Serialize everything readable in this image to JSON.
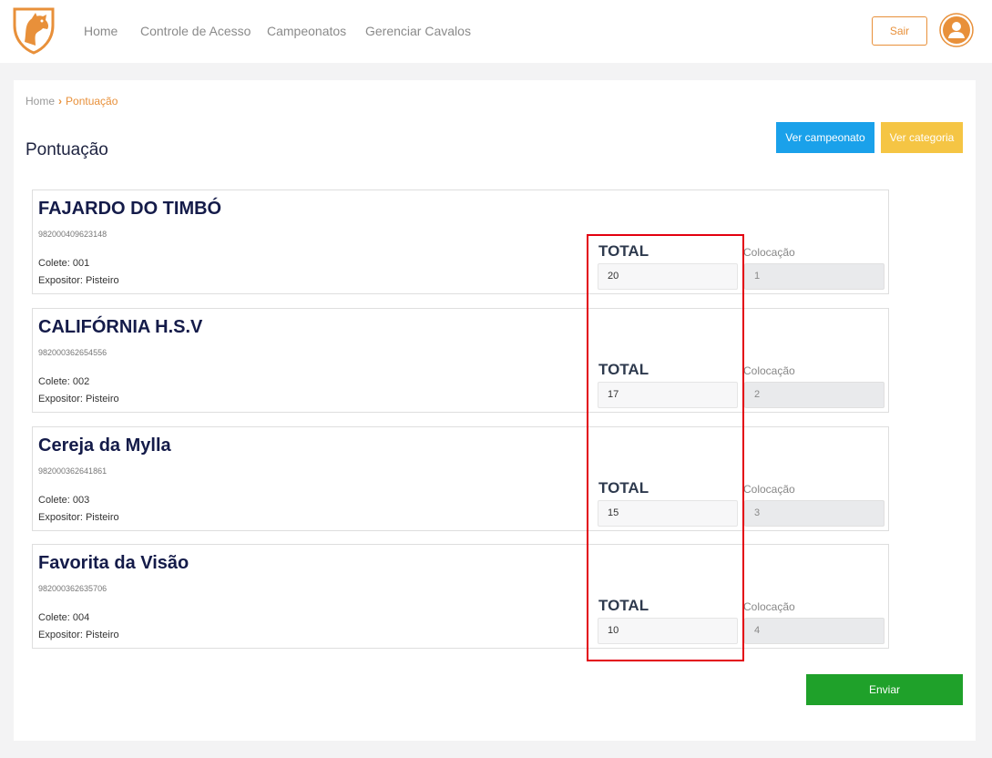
{
  "nav": {
    "items": [
      "Home",
      "Controle de Acesso",
      "Campeonatos",
      "Gerenciar Cavalos"
    ],
    "logout_label": "Sair"
  },
  "breadcrumb": {
    "home": "Home",
    "current": "Pontuação"
  },
  "page": {
    "title": "Pontuação",
    "ver_campeonato": "Ver campeonato",
    "ver_categoria": "Ver categoria",
    "submit_label": "Enviar"
  },
  "horses": [
    {
      "name": "FAJARDO DO TIMBÓ",
      "chip": "982000409623148",
      "colete": "Colete: 001",
      "expositor": "Expositor: Pisteiro",
      "total_label": "TOTAL",
      "total": "20",
      "colocacao_label": "Colocação",
      "colocacao": "1"
    },
    {
      "name": "CALIFÓRNIA H.S.V",
      "chip": "982000362654556",
      "colete": "Colete: 002",
      "expositor": "Expositor: Pisteiro",
      "total_label": "TOTAL",
      "total": "17",
      "colocacao_label": "Colocação",
      "colocacao": "2"
    },
    {
      "name": "Cereja da Mylla",
      "chip": "982000362641861",
      "colete": "Colete: 003",
      "expositor": "Expositor: Pisteiro",
      "total_label": "TOTAL",
      "total": "15",
      "colocacao_label": "Colocação",
      "colocacao": "3"
    },
    {
      "name": "Favorita da Visão",
      "chip": "982000362635706",
      "colete": "Colete: 004",
      "expositor": "Expositor: Pisteiro",
      "total_label": "TOTAL",
      "total": "10",
      "colocacao_label": "Colocação",
      "colocacao": "4"
    }
  ],
  "colors": {
    "accent": "#e8903a",
    "primary_button": "#1aa1ea",
    "warning_button": "#f5c544",
    "success_button": "#1fa12a",
    "highlight_box": "#e3000f"
  },
  "icons": {
    "logo": "horse-shield-logo",
    "avatar": "user-avatar-icon"
  }
}
